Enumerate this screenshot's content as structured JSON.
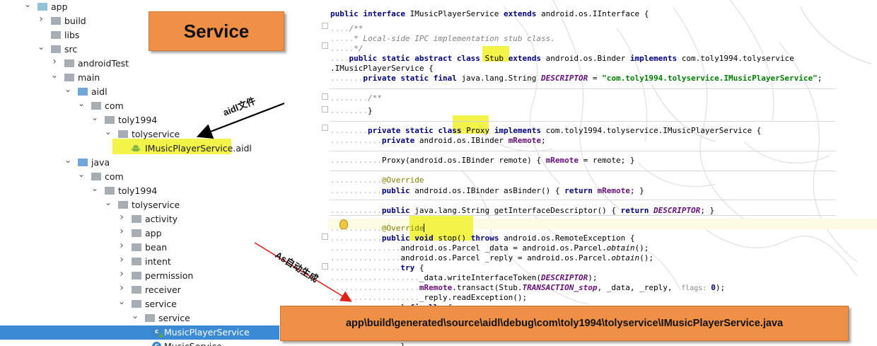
{
  "tree": [
    {
      "label": "app",
      "arrow": "down",
      "icon": "folder-teal",
      "depth": 0
    },
    {
      "label": "build",
      "arrow": "right",
      "icon": "folder-plain",
      "depth": 1
    },
    {
      "label": "libs",
      "arrow": "none",
      "icon": "folder-plain",
      "depth": 1
    },
    {
      "label": "src",
      "arrow": "down",
      "icon": "folder-plain",
      "depth": 1
    },
    {
      "label": "androidTest",
      "arrow": "right",
      "icon": "folder-plain",
      "depth": 2
    },
    {
      "label": "main",
      "arrow": "down",
      "icon": "folder-plain",
      "depth": 2
    },
    {
      "label": "aidl",
      "arrow": "down",
      "icon": "folder-blue",
      "depth": 3
    },
    {
      "label": "com",
      "arrow": "down",
      "icon": "folder-plain",
      "depth": 4
    },
    {
      "label": "toly1994",
      "arrow": "down",
      "icon": "folder-plain",
      "depth": 5
    },
    {
      "label": "tolyservice",
      "arrow": "down",
      "icon": "folder-plain",
      "depth": 6
    },
    {
      "label": "IMusicPlayerService.aidl",
      "arrow": "none",
      "icon": "android",
      "depth": 7
    },
    {
      "label": "java",
      "arrow": "down",
      "icon": "folder-blue",
      "depth": 3
    },
    {
      "label": "com",
      "arrow": "down",
      "icon": "folder-plain",
      "depth": 4
    },
    {
      "label": "toly1994",
      "arrow": "down",
      "icon": "folder-plain",
      "depth": 5
    },
    {
      "label": "tolyservice",
      "arrow": "down",
      "icon": "folder-plain",
      "depth": 6
    },
    {
      "label": "activity",
      "arrow": "right",
      "icon": "folder-plain",
      "depth": 7
    },
    {
      "label": "app",
      "arrow": "right",
      "icon": "folder-plain",
      "depth": 7
    },
    {
      "label": "bean",
      "arrow": "right",
      "icon": "folder-plain",
      "depth": 7
    },
    {
      "label": "intent",
      "arrow": "right",
      "icon": "folder-plain",
      "depth": 7
    },
    {
      "label": "permission",
      "arrow": "right",
      "icon": "folder-plain",
      "depth": 7
    },
    {
      "label": "receiver",
      "arrow": "right",
      "icon": "folder-plain",
      "depth": 7
    },
    {
      "label": "service",
      "arrow": "down",
      "icon": "folder-plain",
      "depth": 7
    },
    {
      "label": "service",
      "arrow": "down",
      "icon": "folder-plain",
      "depth": 8
    },
    {
      "label": "MusicPlayerService",
      "arrow": "none",
      "icon": "class",
      "depth": 10,
      "selected": true
    },
    {
      "label": "MusicService",
      "arrow": "none",
      "icon": "class",
      "depth": 10
    }
  ],
  "overlays": {
    "service_title": "Service",
    "aidl_note": "aidl文件",
    "as_note": "As自动生成",
    "generated_path": "app\\build\\generated\\source\\aidl\\debug\\com\\toly1994\\tolyservice\\IMusicPlayerService.java"
  },
  "code": {
    "l1": [
      [
        "kw",
        "public interface "
      ],
      [
        "p",
        "IMusicPlayerService "
      ],
      [
        "kw",
        "extends "
      ],
      [
        "p",
        "android.os.IInterface {"
      ]
    ],
    "l2": [
      [
        "d",
        "...."
      ],
      [
        "cm",
        "/**"
      ]
    ],
    "l3": [
      [
        "d",
        "....."
      ],
      [
        "cm",
        "* Local-side IPC implementation stub class."
      ]
    ],
    "l4": [
      [
        "d",
        "....."
      ],
      [
        "cm",
        "*/"
      ]
    ],
    "l5": [
      [
        "d",
        "...."
      ],
      [
        "kw",
        "public static abstract class "
      ],
      [
        "p",
        "Stub"
      ],
      [
        "p",
        " "
      ],
      [
        "kw",
        "extends "
      ],
      [
        "p",
        "android.os.Binder "
      ],
      [
        "kw",
        "implements "
      ],
      [
        "p",
        "com.toly1994.tolyservice"
      ]
    ],
    "l6": [
      [
        "p",
        ".IMusicPlayerService {"
      ]
    ],
    "l7": [
      [
        "d",
        "......."
      ],
      [
        "kw",
        "private static final "
      ],
      [
        "p",
        "java.lang.String "
      ],
      [
        "sfld",
        "DESCRIPTOR"
      ],
      [
        "p",
        " = "
      ],
      [
        "str",
        "\"com.toly1994.tolyservice.IMusicPlayerService\""
      ],
      [
        "p",
        ";"
      ]
    ],
    "l8": [
      [
        "d",
        "........"
      ],
      [
        "cm",
        "/**"
      ]
    ],
    "l9": [
      [
        "d",
        "........"
      ],
      [
        "p",
        "}"
      ]
    ],
    "l10": [
      [
        "d",
        "........"
      ],
      [
        "kw",
        "private static class "
      ],
      [
        "p",
        "Proxy"
      ],
      [
        "p",
        " "
      ],
      [
        "kw",
        "implements "
      ],
      [
        "p",
        "com.toly1994.tolyservice.IMusicPlayerService {"
      ]
    ],
    "l11": [
      [
        "d",
        "..........."
      ],
      [
        "kw",
        "private "
      ],
      [
        "p",
        "android.os.IBinder "
      ],
      [
        "fld",
        "mRemote"
      ],
      [
        "p",
        ";"
      ]
    ],
    "l12": [
      [
        "d",
        "..........."
      ],
      [
        "p",
        "Proxy(android.os.IBinder remote) { "
      ],
      [
        "fld",
        "mRemote"
      ],
      [
        "p",
        " = remote; }"
      ]
    ],
    "l13": [
      [
        "d",
        "..........."
      ],
      [
        "ann",
        "@Override"
      ]
    ],
    "l14": [
      [
        "d",
        "..........."
      ],
      [
        "kw",
        "public "
      ],
      [
        "p",
        "android.os.IBinder asBinder() { "
      ],
      [
        "kw",
        "return "
      ],
      [
        "fld",
        "mRemote"
      ],
      [
        "p",
        "; }"
      ]
    ],
    "l15": [
      [
        "d",
        "..........."
      ],
      [
        "kw",
        "public "
      ],
      [
        "p",
        "java.lang.String getInterfaceDescriptor() { "
      ],
      [
        "kw",
        "return "
      ],
      [
        "sfld",
        "DESCRIPTOR"
      ],
      [
        "p",
        "; }"
      ]
    ],
    "l16": [
      [
        "d",
        "..........."
      ],
      [
        "ann",
        "@Override"
      ]
    ],
    "l17": [
      [
        "d",
        "..........."
      ],
      [
        "kw",
        "public void "
      ],
      [
        "p",
        "stop() "
      ],
      [
        "kw",
        "throws "
      ],
      [
        "p",
        "android.os.RemoteException {"
      ]
    ],
    "l18": [
      [
        "d",
        "..............."
      ],
      [
        "p",
        "android.os.Parcel _data = android.os.Parcel."
      ],
      [
        "ital",
        "obtain"
      ],
      [
        "p",
        "();"
      ]
    ],
    "l19": [
      [
        "d",
        "..............."
      ],
      [
        "p",
        "android.os.Parcel _reply = android.os.Parcel."
      ],
      [
        "ital",
        "obtain"
      ],
      [
        "p",
        "();"
      ]
    ],
    "l20": [
      [
        "d",
        "..............."
      ],
      [
        "kw",
        "try "
      ],
      [
        "p",
        "{"
      ]
    ],
    "l21": [
      [
        "d",
        "..................."
      ],
      [
        "p",
        "_data.writeInterfaceToken("
      ],
      [
        "sfld",
        "DESCRIPTOR"
      ],
      [
        "p",
        ");"
      ]
    ],
    "l22": [
      [
        "d",
        "..................."
      ],
      [
        "fld",
        "mRemote"
      ],
      [
        "p",
        ".transact(Stub."
      ],
      [
        "sfld",
        "TRANSACTION_stop"
      ],
      [
        "p",
        ", _data, _reply, "
      ],
      [
        "hint",
        " flags: "
      ],
      [
        "kw",
        "0"
      ],
      [
        "p",
        ");"
      ]
    ],
    "l23": [
      [
        "d",
        "..................."
      ],
      [
        "p",
        "_reply.readException();"
      ]
    ],
    "l24": [
      [
        "d",
        "..............."
      ],
      [
        "p",
        "} "
      ],
      [
        "kw",
        "finally "
      ],
      [
        "p",
        "{"
      ]
    ],
    "l25": [
      [
        "d",
        "..............."
      ],
      [
        "p",
        "}"
      ]
    ]
  }
}
